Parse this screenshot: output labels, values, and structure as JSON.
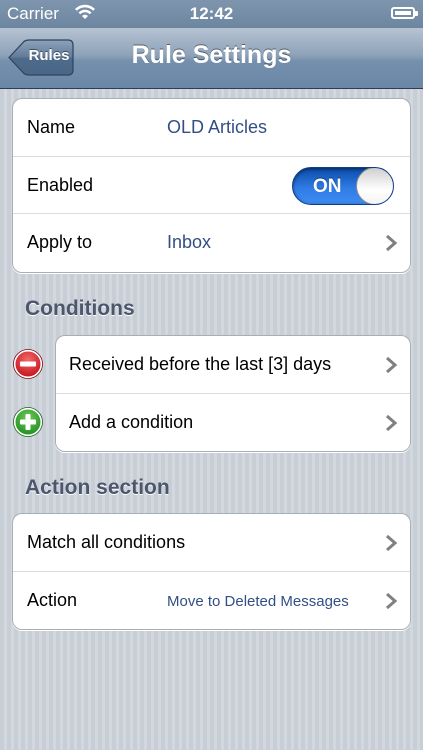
{
  "status_bar": {
    "carrier": "Carrier",
    "time": "12:42"
  },
  "nav": {
    "title": "Rule Settings",
    "back_label": "Rules"
  },
  "rule": {
    "name_label": "Name",
    "name_value": "OLD Articles",
    "enabled_label": "Enabled",
    "enabled_state": "ON",
    "apply_label": "Apply to",
    "apply_value": "Inbox"
  },
  "conditions": {
    "header": "Conditions",
    "items": [
      {
        "label": "Received before the last [3] days"
      }
    ],
    "add_label": "Add a condition"
  },
  "actions": {
    "header": "Action section",
    "match_label": "Match all conditions",
    "action_label": "Action",
    "action_value": "Move to Deleted Messages"
  },
  "colors": {
    "accent_value": "#324f85",
    "toggle_on": "#2f7be5",
    "delete_red": "#d9222a",
    "add_green": "#2e9e2b"
  }
}
